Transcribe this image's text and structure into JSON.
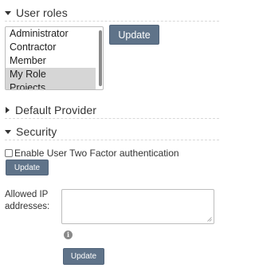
{
  "user_roles": {
    "title": "User roles",
    "options": [
      "Administrator",
      "Contractor",
      "Member",
      "My Role",
      "Projects"
    ],
    "selected": [
      "My Role",
      "Projects"
    ],
    "update_label": "Update"
  },
  "default_provider": {
    "title": "Default Provider"
  },
  "security": {
    "title": "Security",
    "two_factor_label": "Enable User Two Factor authentication",
    "two_factor_checked": false,
    "update_label": "Update",
    "allowed_ip_label": "Allowed IP addresses:",
    "allowed_ip_value": "",
    "save_label": "Update"
  },
  "colors": {
    "button_bg": "#5f7389",
    "selected_row": "#d6d6d6"
  }
}
